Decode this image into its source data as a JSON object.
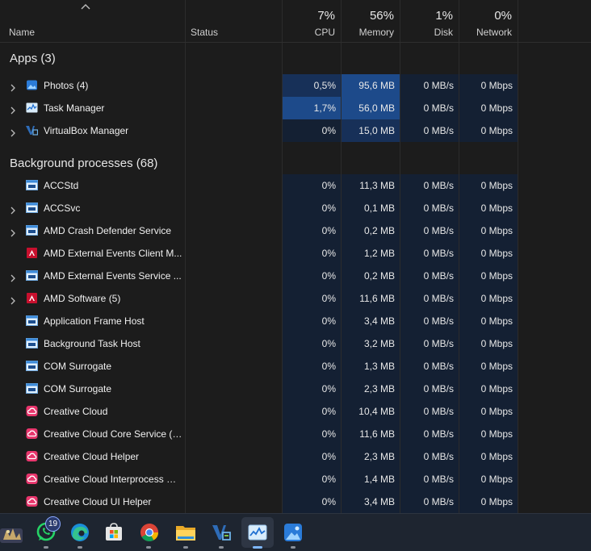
{
  "header": {
    "name_label": "Name",
    "status_label": "Status",
    "cpu": {
      "pct": "7%",
      "label": "CPU"
    },
    "memory": {
      "pct": "56%",
      "label": "Memory"
    },
    "disk": {
      "pct": "1%",
      "label": "Disk"
    },
    "network": {
      "pct": "0%",
      "label": "Network"
    }
  },
  "sections": {
    "apps": "Apps (3)",
    "background": "Background processes (68)"
  },
  "apps": [
    {
      "name": "Photos (4)",
      "icon": "photos-icon",
      "cpu": "0,5%",
      "mem": "95,6 MB",
      "disk": "0 MB/s",
      "net": "0 Mbps"
    },
    {
      "name": "Task Manager",
      "icon": "task-manager-icon",
      "cpu": "1,7%",
      "mem": "56,0 MB",
      "disk": "0 MB/s",
      "net": "0 Mbps"
    },
    {
      "name": "VirtualBox Manager",
      "icon": "virtualbox-icon",
      "cpu": "0%",
      "mem": "15,0 MB",
      "disk": "0 MB/s",
      "net": "0 Mbps"
    }
  ],
  "background": [
    {
      "name": "ACCStd",
      "icon": "window-icon",
      "cpu": "0%",
      "mem": "11,3 MB",
      "disk": "0 MB/s",
      "net": "0 Mbps"
    },
    {
      "name": "ACCSvc",
      "icon": "window-icon",
      "cpu": "0%",
      "mem": "0,1 MB",
      "disk": "0 MB/s",
      "net": "0 Mbps"
    },
    {
      "name": "AMD Crash Defender Service",
      "icon": "window-icon",
      "cpu": "0%",
      "mem": "0,2 MB",
      "disk": "0 MB/s",
      "net": "0 Mbps"
    },
    {
      "name": "AMD External Events Client M...",
      "icon": "amd-icon",
      "cpu": "0%",
      "mem": "1,2 MB",
      "disk": "0 MB/s",
      "net": "0 Mbps"
    },
    {
      "name": "AMD External Events Service ...",
      "icon": "window-icon",
      "cpu": "0%",
      "mem": "0,2 MB",
      "disk": "0 MB/s",
      "net": "0 Mbps"
    },
    {
      "name": "AMD Software (5)",
      "icon": "amd-icon",
      "cpu": "0%",
      "mem": "11,6 MB",
      "disk": "0 MB/s",
      "net": "0 Mbps"
    },
    {
      "name": "Application Frame Host",
      "icon": "window-icon",
      "cpu": "0%",
      "mem": "3,4 MB",
      "disk": "0 MB/s",
      "net": "0 Mbps"
    },
    {
      "name": "Background Task Host",
      "icon": "window-icon",
      "cpu": "0%",
      "mem": "3,2 MB",
      "disk": "0 MB/s",
      "net": "0 Mbps"
    },
    {
      "name": "COM Surrogate",
      "icon": "window-icon",
      "cpu": "0%",
      "mem": "1,3 MB",
      "disk": "0 MB/s",
      "net": "0 Mbps"
    },
    {
      "name": "COM Surrogate",
      "icon": "window-icon",
      "cpu": "0%",
      "mem": "2,3 MB",
      "disk": "0 MB/s",
      "net": "0 Mbps"
    },
    {
      "name": "Creative Cloud",
      "icon": "creative-cloud-icon",
      "cpu": "0%",
      "mem": "10,4 MB",
      "disk": "0 MB/s",
      "net": "0 Mbps"
    },
    {
      "name": "Creative Cloud Core Service (3...",
      "icon": "creative-cloud-icon",
      "cpu": "0%",
      "mem": "11,6 MB",
      "disk": "0 MB/s",
      "net": "0 Mbps"
    },
    {
      "name": "Creative Cloud Helper",
      "icon": "creative-cloud-icon",
      "cpu": "0%",
      "mem": "2,3 MB",
      "disk": "0 MB/s",
      "net": "0 Mbps"
    },
    {
      "name": "Creative Cloud Interprocess Se...",
      "icon": "creative-cloud-icon",
      "cpu": "0%",
      "mem": "1,4 MB",
      "disk": "0 MB/s",
      "net": "0 Mbps"
    },
    {
      "name": "Creative Cloud UI Helper",
      "icon": "creative-cloud-icon",
      "cpu": "0%",
      "mem": "3,4 MB",
      "disk": "0 MB/s",
      "net": "0 Mbps"
    }
  ],
  "taskbar": {
    "whatsapp_badge": "19",
    "items": [
      "widgets-icon",
      "whatsapp-icon",
      "edge-icon",
      "microsoft-store-icon",
      "chrome-icon",
      "file-explorer-icon",
      "virtualbox-icon",
      "task-manager-icon",
      "photos-icon"
    ]
  },
  "colors": {
    "heat_light": "#142033",
    "heat_mid": "#173058",
    "heat_dark": "#1d4a8a",
    "accent": "#7fb8ff"
  }
}
